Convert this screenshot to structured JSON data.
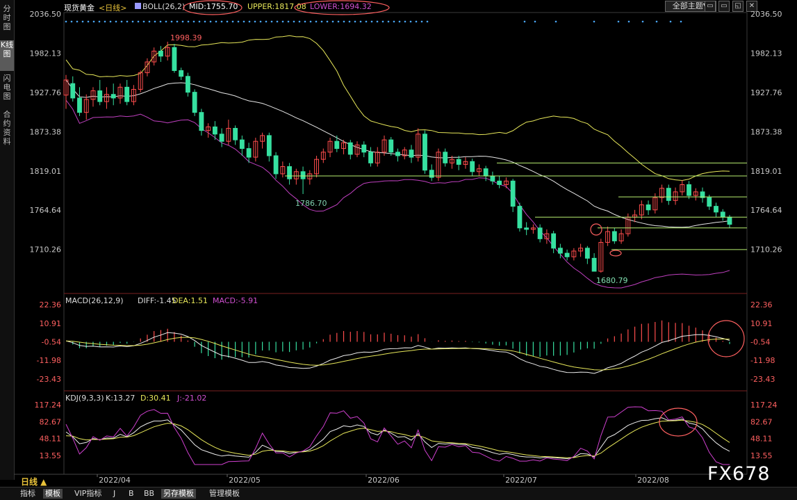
{
  "left_tabs": [
    {
      "label": "分时图",
      "active": false
    },
    {
      "label": "K线图",
      "active": true
    },
    {
      "label": "闪电图",
      "active": false
    },
    {
      "label": "合约资料",
      "active": false
    }
  ],
  "header": {
    "symbol": "现货黄金",
    "period_tag": "<日线>",
    "boll_label": "BOLL(26,2)",
    "mid": "MID:1755.70",
    "upper": "UPPER:1817.08",
    "lower": "LOWER:1694.32",
    "theme_button": "全部主题▼",
    "window_buttons": [
      "▭",
      "▭",
      "◱",
      "✕"
    ]
  },
  "price_axis": {
    "ticks": [
      "2036.50",
      "1982.13",
      "1927.76",
      "1873.38",
      "1819.01",
      "1764.64",
      "1710.26"
    ],
    "min": 1655,
    "max": 2036.5
  },
  "annotations": {
    "high": "1998.39",
    "low1": "1786.70",
    "low2": "1680.79"
  },
  "macd": {
    "title": "MACD(26,12,9)",
    "diff": "DIFF:-1.45",
    "dea": "DEA:1.51",
    "macd": "MACD:-5.91",
    "ticks": [
      "22.36",
      "10.91",
      "-0.54",
      "-11.98",
      "-23.43"
    ]
  },
  "kdj": {
    "title": "KDJ(9,3,3)",
    "k": "K:13.27",
    "d": "D:30.41",
    "j": "J:-21.02",
    "ticks": [
      "117.24",
      "82.67",
      "48.11",
      "13.55"
    ]
  },
  "x_axis": {
    "labels": [
      "2022/04",
      "2022/05",
      "2022/06",
      "2022/07",
      "2022/08"
    ]
  },
  "period_button": "日线 ▲",
  "bottom_tabs": [
    {
      "label": "指标",
      "active": false
    },
    {
      "label": "模板",
      "active": true
    },
    {
      "label": "VIP指标",
      "active": false
    },
    {
      "label": "J",
      "active": false
    },
    {
      "label": "B",
      "active": false
    },
    {
      "label": "BB",
      "active": false
    },
    {
      "label": "另存模板",
      "active": true
    },
    {
      "label": "管理模板",
      "active": false
    }
  ],
  "watermark": "FX678",
  "colors": {
    "up": "#ff4d4d",
    "down": "#36e0a0",
    "upper": "#e8e85a",
    "mid": "#e6e6e6",
    "lower": "#c040c0",
    "highlight": "#ff6060"
  },
  "candles": [
    [
      1924,
      1945,
      1905,
      1952
    ],
    [
      1940,
      1920,
      1915,
      1950
    ],
    [
      1920,
      1900,
      1895,
      1935
    ],
    [
      1900,
      1918,
      1890,
      1925
    ],
    [
      1918,
      1930,
      1908,
      1935
    ],
    [
      1930,
      1915,
      1910,
      1945
    ],
    [
      1915,
      1925,
      1905,
      1935
    ],
    [
      1925,
      1920,
      1910,
      1940
    ],
    [
      1920,
      1935,
      1912,
      1940
    ],
    [
      1935,
      1915,
      1910,
      1945
    ],
    [
      1915,
      1932,
      1910,
      1938
    ],
    [
      1932,
      1955,
      1928,
      1958
    ],
    [
      1955,
      1970,
      1950,
      1975
    ],
    [
      1970,
      1985,
      1965,
      1990
    ],
    [
      1985,
      1978,
      1970,
      1992
    ],
    [
      1978,
      1990,
      1972,
      1998
    ],
    [
      1990,
      1958,
      1955,
      1995
    ],
    [
      1958,
      1950,
      1945,
      1962
    ],
    [
      1950,
      1928,
      1922,
      1955
    ],
    [
      1928,
      1900,
      1895,
      1932
    ],
    [
      1900,
      1875,
      1868,
      1905
    ],
    [
      1875,
      1880,
      1865,
      1885
    ],
    [
      1880,
      1870,
      1862,
      1888
    ],
    [
      1870,
      1860,
      1852,
      1878
    ],
    [
      1860,
      1878,
      1855,
      1890
    ],
    [
      1878,
      1862,
      1855,
      1882
    ],
    [
      1862,
      1850,
      1840,
      1868
    ],
    [
      1850,
      1838,
      1830,
      1858
    ],
    [
      1838,
      1860,
      1832,
      1865
    ],
    [
      1860,
      1868,
      1850,
      1872
    ],
    [
      1868,
      1840,
      1832,
      1872
    ],
    [
      1840,
      1815,
      1808,
      1845
    ],
    [
      1815,
      1825,
      1810,
      1832
    ],
    [
      1825,
      1808,
      1800,
      1830
    ],
    [
      1808,
      1818,
      1800,
      1822
    ],
    [
      1818,
      1808,
      1787,
      1825
    ],
    [
      1808,
      1815,
      1800,
      1820
    ],
    [
      1815,
      1835,
      1810,
      1840
    ],
    [
      1835,
      1845,
      1830,
      1850
    ],
    [
      1845,
      1860,
      1838,
      1865
    ],
    [
      1860,
      1850,
      1845,
      1868
    ],
    [
      1850,
      1858,
      1842,
      1862
    ],
    [
      1858,
      1842,
      1835,
      1862
    ],
    [
      1842,
      1855,
      1838,
      1860
    ],
    [
      1855,
      1845,
      1838,
      1860
    ],
    [
      1845,
      1830,
      1825,
      1852
    ],
    [
      1830,
      1845,
      1825,
      1852
    ],
    [
      1845,
      1862,
      1840,
      1868
    ],
    [
      1862,
      1845,
      1840,
      1866
    ],
    [
      1845,
      1840,
      1832,
      1850
    ],
    [
      1840,
      1848,
      1835,
      1852
    ],
    [
      1848,
      1838,
      1830,
      1855
    ],
    [
      1838,
      1870,
      1832,
      1878
    ],
    [
      1870,
      1820,
      1815,
      1875
    ],
    [
      1820,
      1810,
      1805,
      1828
    ],
    [
      1810,
      1845,
      1805,
      1850
    ],
    [
      1845,
      1830,
      1825,
      1850
    ],
    [
      1830,
      1835,
      1822,
      1840
    ],
    [
      1835,
      1828,
      1820,
      1840
    ],
    [
      1828,
      1832,
      1822,
      1838
    ],
    [
      1832,
      1818,
      1812,
      1836
    ],
    [
      1818,
      1822,
      1812,
      1828
    ],
    [
      1822,
      1812,
      1805,
      1826
    ],
    [
      1812,
      1805,
      1800,
      1818
    ],
    [
      1805,
      1800,
      1795,
      1812
    ],
    [
      1800,
      1805,
      1795,
      1810
    ],
    [
      1805,
      1770,
      1762,
      1808
    ],
    [
      1770,
      1740,
      1735,
      1775
    ],
    [
      1740,
      1738,
      1730,
      1748
    ],
    [
      1738,
      1740,
      1732,
      1745
    ],
    [
      1740,
      1725,
      1720,
      1745
    ],
    [
      1725,
      1732,
      1718,
      1738
    ],
    [
      1732,
      1712,
      1705,
      1736
    ],
    [
      1712,
      1705,
      1698,
      1718
    ],
    [
      1705,
      1700,
      1695,
      1710
    ],
    [
      1700,
      1708,
      1695,
      1712
    ],
    [
      1708,
      1712,
      1700,
      1718
    ],
    [
      1712,
      1698,
      1690,
      1715
    ],
    [
      1698,
      1680,
      1681,
      1705
    ],
    [
      1680,
      1720,
      1678,
      1725
    ],
    [
      1720,
      1735,
      1715,
      1742
    ],
    [
      1735,
      1722,
      1718,
      1740
    ],
    [
      1722,
      1732,
      1718,
      1738
    ],
    [
      1732,
      1755,
      1728,
      1760
    ],
    [
      1755,
      1758,
      1748,
      1765
    ],
    [
      1758,
      1772,
      1752,
      1778
    ],
    [
      1772,
      1765,
      1758,
      1778
    ],
    [
      1765,
      1782,
      1760,
      1788
    ],
    [
      1782,
      1795,
      1775,
      1800
    ],
    [
      1795,
      1778,
      1772,
      1800
    ],
    [
      1778,
      1790,
      1772,
      1796
    ],
    [
      1790,
      1800,
      1785,
      1806
    ],
    [
      1800,
      1785,
      1780,
      1805
    ],
    [
      1785,
      1790,
      1778,
      1795
    ],
    [
      1790,
      1782,
      1775,
      1796
    ],
    [
      1782,
      1770,
      1765,
      1786
    ],
    [
      1770,
      1762,
      1755,
      1775
    ],
    [
      1762,
      1755,
      1750,
      1766
    ],
    [
      1755,
      1745,
      1740,
      1758
    ]
  ]
}
